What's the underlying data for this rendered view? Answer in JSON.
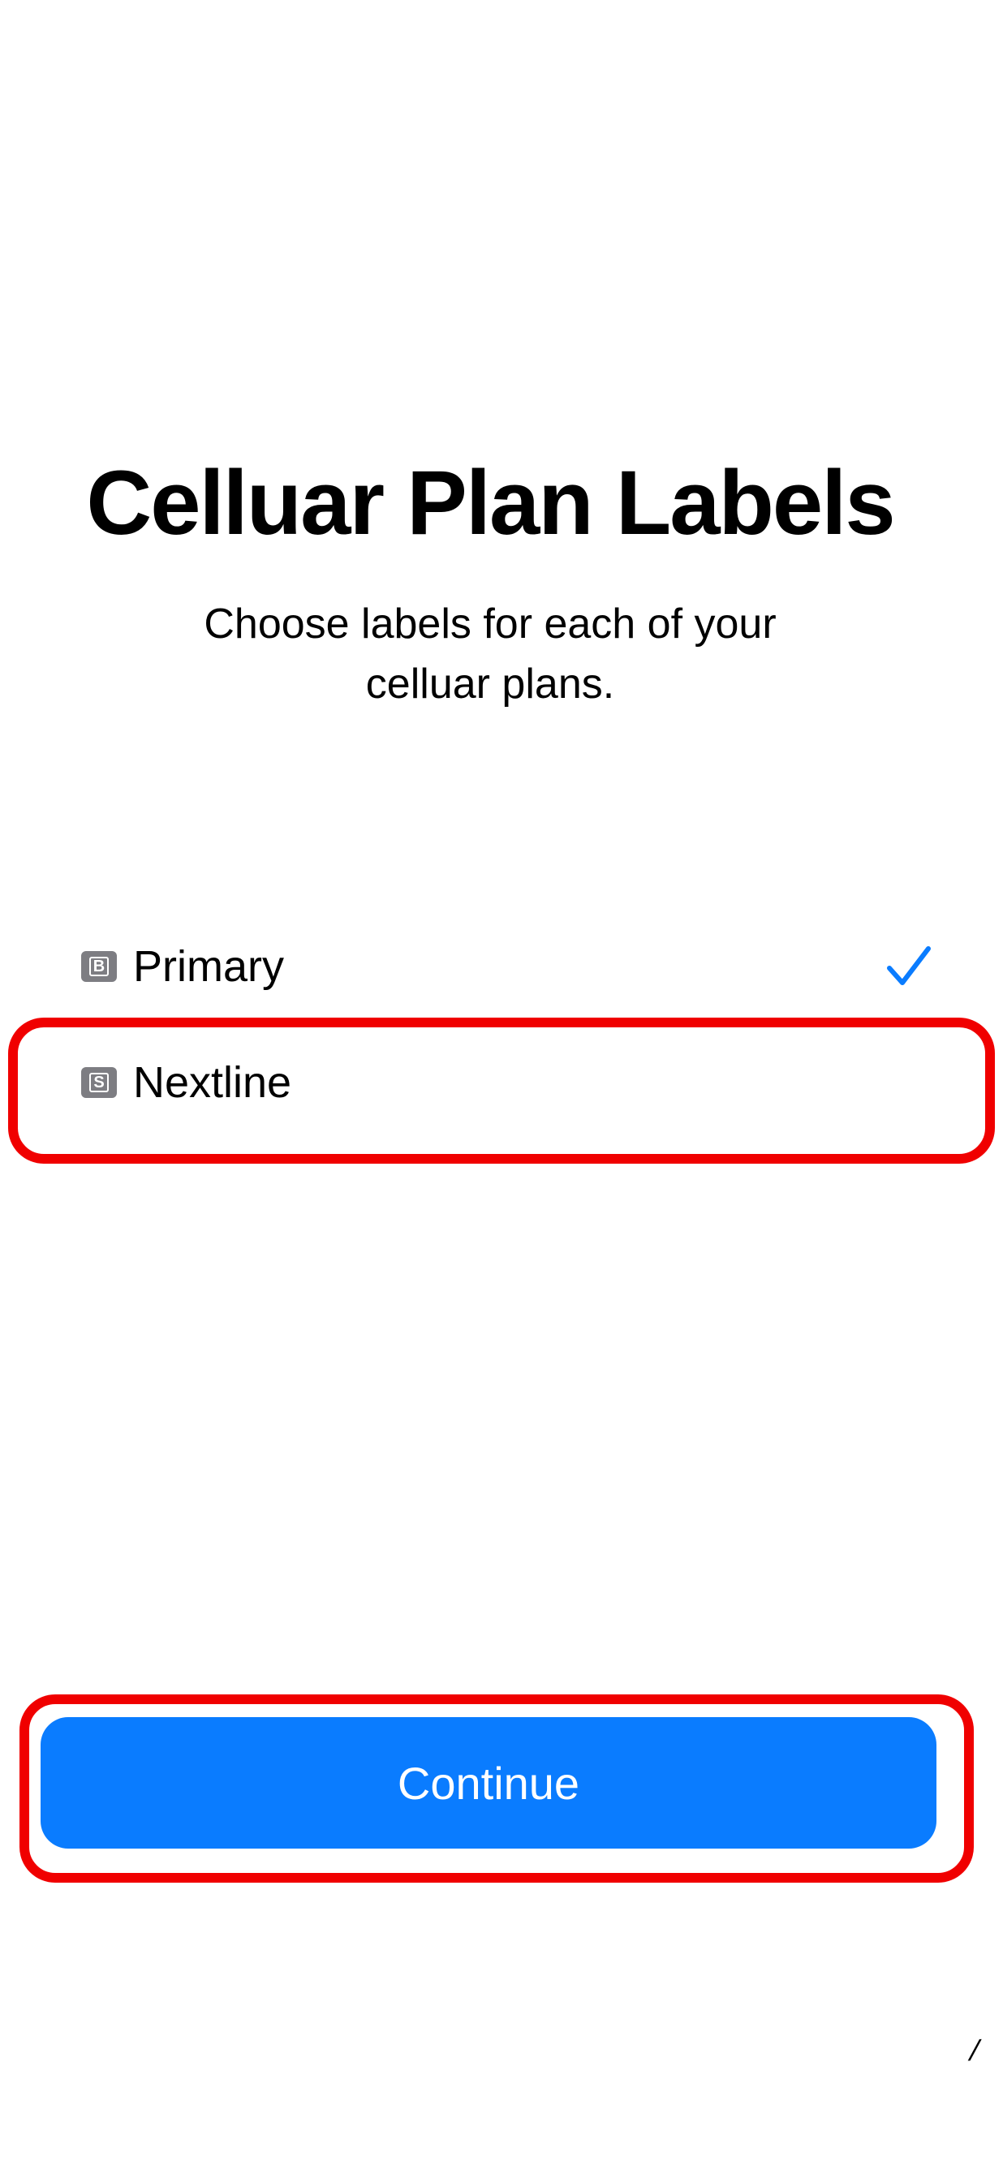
{
  "header": {
    "title": "Celluar Plan Labels",
    "subtitle": "Choose labels for each of your celluar plans."
  },
  "plans": [
    {
      "badge": "B",
      "label": "Primary",
      "selected": true
    },
    {
      "badge": "S",
      "label": "Nextline",
      "selected": false
    }
  ],
  "footer": {
    "continue_label": "Continue"
  },
  "colors": {
    "accent": "#0a7cff",
    "highlight": "#f00000",
    "badge": "#7d7d82"
  },
  "icons": {
    "checkmark": "checkmark-icon",
    "sim": "sim-badge-icon"
  }
}
